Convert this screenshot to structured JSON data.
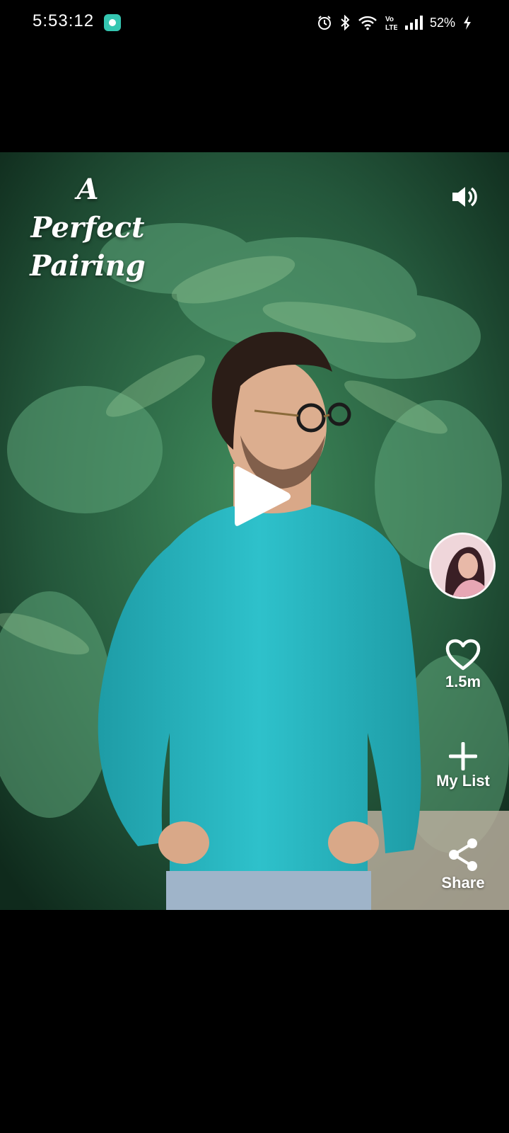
{
  "status_bar": {
    "time": "5:53:12",
    "battery_percent": "52%",
    "icons": [
      "app-notification-icon",
      "alarm-icon",
      "bluetooth-icon",
      "wifi-icon",
      "volte-icon",
      "signal-icon",
      "battery-charging-icon"
    ],
    "volte_label": "Vo LTE"
  },
  "video": {
    "title_line1": "A Perfect",
    "title_line2": "Pairing",
    "volume_icon": "volume-icon",
    "play_icon": "play-icon",
    "colors": {
      "shirt": "#2bb8c4",
      "foliage": "#2e6b47",
      "background": "#000000"
    }
  },
  "actions": {
    "like_count": "1.5m",
    "my_list_label": "My List",
    "share_label": "Share"
  }
}
